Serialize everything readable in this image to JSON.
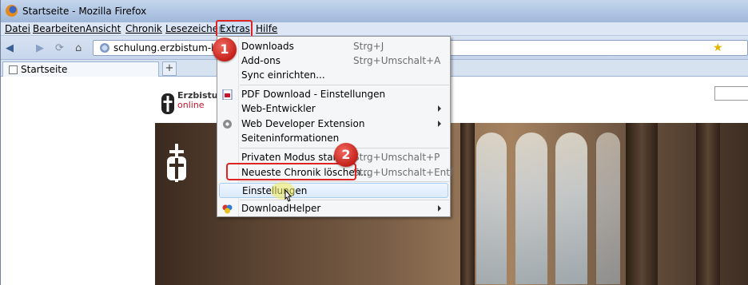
{
  "window": {
    "title": "Startseite - Mozilla Firefox"
  },
  "menubar": {
    "items": [
      "Datei",
      "Bearbeiten",
      "Ansicht",
      "Chronik",
      "Lesezeichen",
      "Extras",
      "Hilfe"
    ]
  },
  "navbar": {
    "url": "schulung.erzbistum-koeln"
  },
  "tabs": [
    {
      "label": "Startseite"
    }
  ],
  "newtab": "+",
  "page": {
    "logo_line1": "Erzbistu",
    "logo_line2": "online"
  },
  "extras_menu": {
    "items": [
      {
        "label": "Downloads",
        "shortcut": "Strg+J"
      },
      {
        "label": "Add-ons",
        "shortcut": "Strg+Umschalt+A"
      },
      {
        "label": "Sync einrichten..."
      },
      {
        "label": "PDF Download - Einstellungen"
      },
      {
        "label": "Web-Entwickler"
      },
      {
        "label": "Web Developer Extension"
      },
      {
        "label": "Seiteninformationen"
      },
      {
        "label": "Privaten Modus starten",
        "shortcut": "Strg+Umschalt+P"
      },
      {
        "label": "Neueste Chronik löschen...",
        "shortcut": "Strg+Umschalt+Entf"
      },
      {
        "label": "Einstellungen"
      },
      {
        "label": "DownloadHelper"
      }
    ]
  },
  "callouts": [
    "1",
    "2"
  ],
  "colors": {
    "highlight": "#e02424",
    "menu_bg": "#f5f6f7",
    "titlebar": "#aec4e2"
  }
}
